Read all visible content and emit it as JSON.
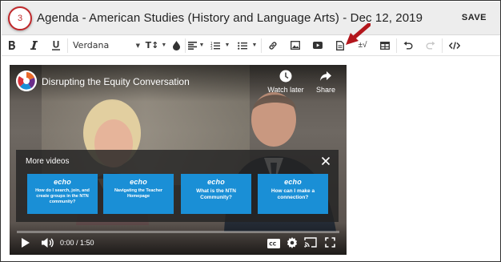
{
  "step_badge": "3",
  "header": {
    "title": "Agenda - American Studies (History and Language Arts) - Dec 12, 2019",
    "save_label": "SAVE"
  },
  "toolbar": {
    "font_name": "Verdana",
    "text_size_label": "T↕",
    "formula_label": "±√",
    "items": [
      "bold-icon",
      "italic-icon",
      "underline-icon",
      "font-select",
      "text-size-icon",
      "color-drop-icon",
      "align-icon",
      "numbered-list-icon",
      "bulleted-list-icon",
      "link-icon",
      "image-icon",
      "youtube-icon",
      "document-icon",
      "formula-icon",
      "table-icon",
      "undo-icon",
      "redo-icon",
      "code-icon"
    ]
  },
  "video": {
    "title": "Disrupting the Equity Conversation",
    "watch_later": "Watch later",
    "share": "Share",
    "more_videos": "More videos",
    "time": "0:00 / 1:50",
    "progress": 0.0,
    "cards": [
      {
        "logo": "echo",
        "text": "How do I search, join, and create groups in the NTN community?"
      },
      {
        "logo": "echo",
        "text": "Navigating the Teacher Homepage"
      },
      {
        "logo": "echo",
        "text": "What is the NTN Community?"
      },
      {
        "logo": "echo",
        "text": "How can I make a connection?"
      }
    ]
  },
  "colors": {
    "badge": "#c0282b",
    "arrow": "#b3161c",
    "card": "#1a8fd6"
  }
}
